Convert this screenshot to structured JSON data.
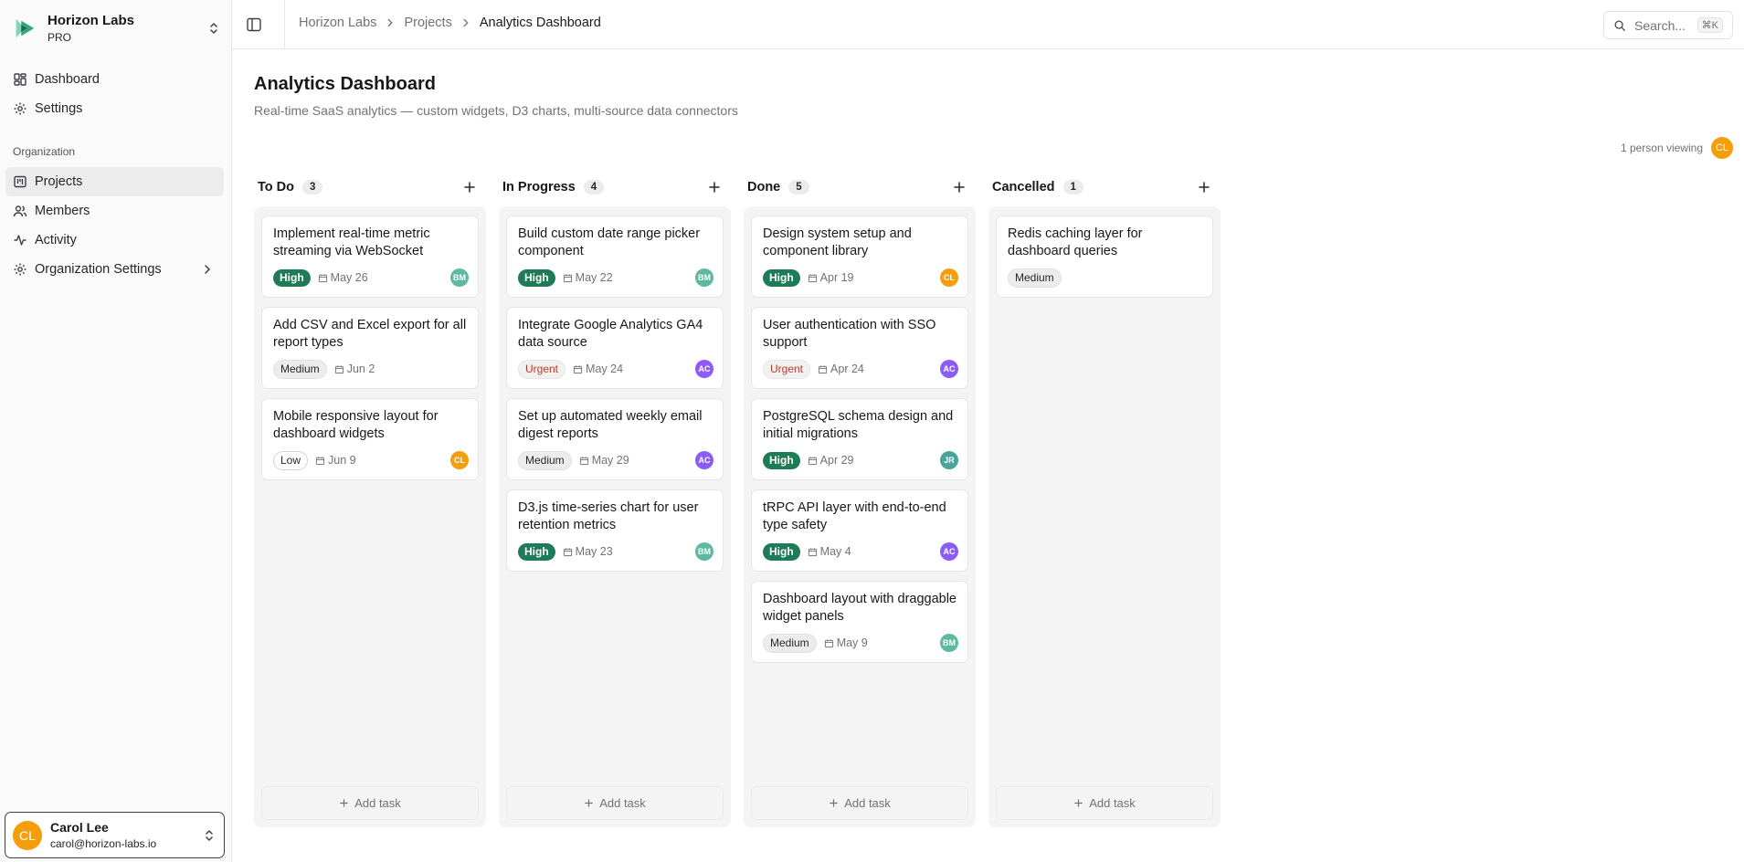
{
  "org": {
    "name": "Horizon Labs",
    "plan": "PRO"
  },
  "nav": {
    "dashboard": "Dashboard",
    "settings": "Settings",
    "section": "Organization",
    "projects": "Projects",
    "members": "Members",
    "activity": "Activity",
    "org_settings": "Organization Settings"
  },
  "user": {
    "initials": "CL",
    "name": "Carol Lee",
    "email": "carol@horizon-labs.io"
  },
  "breadcrumb": [
    "Horizon Labs",
    "Projects",
    "Analytics Dashboard"
  ],
  "search": {
    "label": "Search...",
    "shortcut": "⌘K"
  },
  "page": {
    "title": "Analytics Dashboard",
    "description": "Real-time SaaS analytics — custom widgets, D3 charts, multi-source data connectors",
    "viewers": "1 person viewing",
    "viewer_initials": "CL"
  },
  "add_task_label": "Add task",
  "colors": {
    "high": "#1e7a57",
    "urgent": "#c0392b",
    "BM": "#5fb9a0",
    "AC": "#8b5cf6",
    "CL": "#f59e0b",
    "JR": "#4aa39a"
  },
  "columns": [
    {
      "title": "To Do",
      "count": "3",
      "cards": [
        {
          "title": "Implement real-time metric streaming via WebSocket",
          "priority": "High",
          "due": "May 26",
          "assignee": "BM"
        },
        {
          "title": "Add CSV and Excel export for all report types",
          "priority": "Medium",
          "due": "Jun 2",
          "assignee": ""
        },
        {
          "title": "Mobile responsive layout for dashboard widgets",
          "priority": "Low",
          "due": "Jun 9",
          "assignee": "CL"
        }
      ]
    },
    {
      "title": "In Progress",
      "count": "4",
      "cards": [
        {
          "title": "Build custom date range picker component",
          "priority": "High",
          "due": "May 22",
          "assignee": "BM"
        },
        {
          "title": "Integrate Google Analytics GA4 data source",
          "priority": "Urgent",
          "due": "May 24",
          "assignee": "AC"
        },
        {
          "title": "Set up automated weekly email digest reports",
          "priority": "Medium",
          "due": "May 29",
          "assignee": "AC"
        },
        {
          "title": "D3.js time-series chart for user retention metrics",
          "priority": "High",
          "due": "May 23",
          "assignee": "BM"
        }
      ]
    },
    {
      "title": "Done",
      "count": "5",
      "cards": [
        {
          "title": "Design system setup and component library",
          "priority": "High",
          "due": "Apr 19",
          "assignee": "CL"
        },
        {
          "title": "User authentication with SSO support",
          "priority": "Urgent",
          "due": "Apr 24",
          "assignee": "AC"
        },
        {
          "title": "PostgreSQL schema design and initial migrations",
          "priority": "High",
          "due": "Apr 29",
          "assignee": "JR"
        },
        {
          "title": "tRPC API layer with end-to-end type safety",
          "priority": "High",
          "due": "May 4",
          "assignee": "AC"
        },
        {
          "title": "Dashboard layout with draggable widget panels",
          "priority": "Medium",
          "due": "May 9",
          "assignee": "BM"
        }
      ]
    },
    {
      "title": "Cancelled",
      "count": "1",
      "cards": [
        {
          "title": "Redis caching layer for dashboard queries",
          "priority": "Medium",
          "due": "",
          "assignee": ""
        }
      ]
    }
  ]
}
